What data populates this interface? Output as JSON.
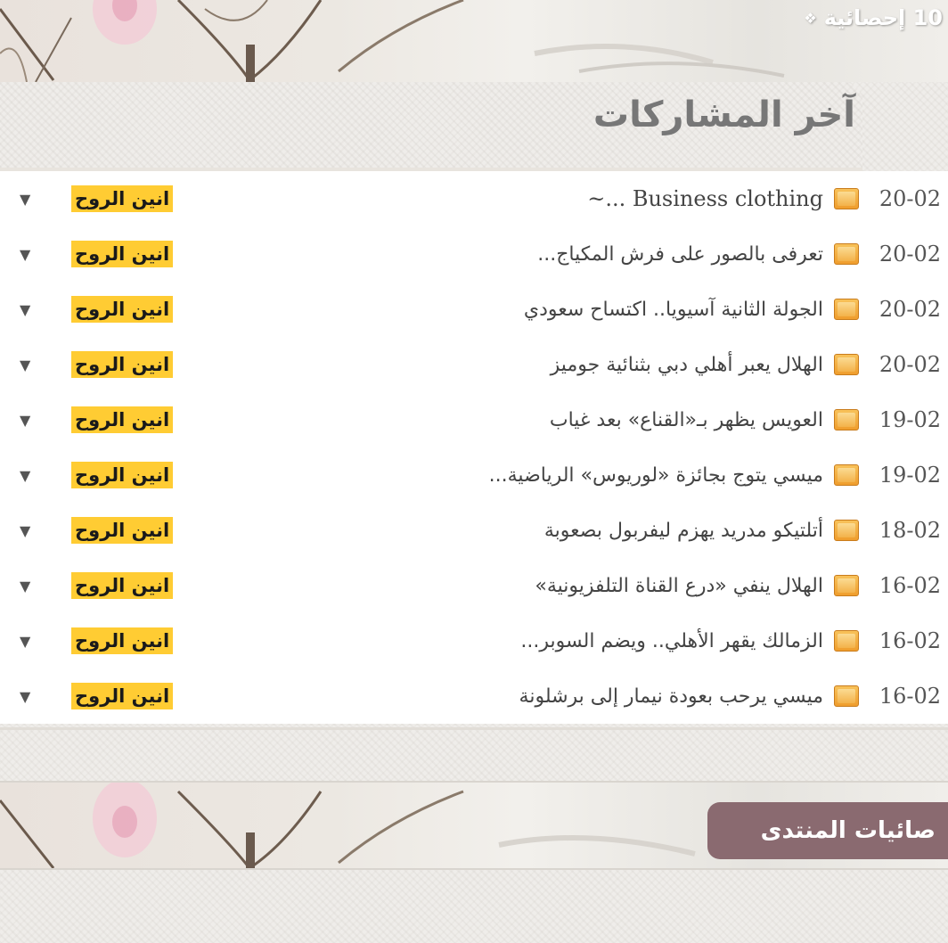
{
  "header": {
    "banner_title": "10 إحصائية",
    "section_title": "آخر المشاركات"
  },
  "posts": [
    {
      "date": "20-02",
      "title": "Business clothing ...~",
      "author": "انين الروح"
    },
    {
      "date": "20-02",
      "title": "تعرفى بالصور على فرش المكياج...",
      "author": "انين الروح"
    },
    {
      "date": "20-02",
      "title": "الجولة الثانية آسيويا.. اكتساح سعودي",
      "author": "انين الروح"
    },
    {
      "date": "20-02",
      "title": "الهلال يعبر أهلي دبي بثنائية جوميز",
      "author": "انين الروح"
    },
    {
      "date": "19-02",
      "title": "العويس يظهر بـ«القناع» بعد غياب",
      "author": "انين الروح"
    },
    {
      "date": "19-02",
      "title": "ميسي يتوج بجائزة «لوريوس» الرياضية...",
      "author": "انين الروح"
    },
    {
      "date": "18-02",
      "title": "أتلتيكو مدريد يهزم ليفربول بصعوبة",
      "author": "انين الروح"
    },
    {
      "date": "16-02",
      "title": "الهلال ينفي «درع القناة التلفزيونية»",
      "author": "انين الروح"
    },
    {
      "date": "16-02",
      "title": "الزمالك يقهر الأهلي.. ويضم السوبر...",
      "author": "انين الروح"
    },
    {
      "date": "16-02",
      "title": "ميسي يرحب بعودة نيمار إلى برشلونة",
      "author": "انين الروح"
    }
  ],
  "footer": {
    "stats_title": "صائيات المنتدى"
  },
  "icons": {
    "post": "folder-icon",
    "expand": "triangle-down-icon",
    "banner": "flower-butterfly-decoration"
  },
  "colors": {
    "author_highlight": "#ffcc33",
    "stats_label_bg": "#8a6a70",
    "icon": "#f2a83a"
  }
}
